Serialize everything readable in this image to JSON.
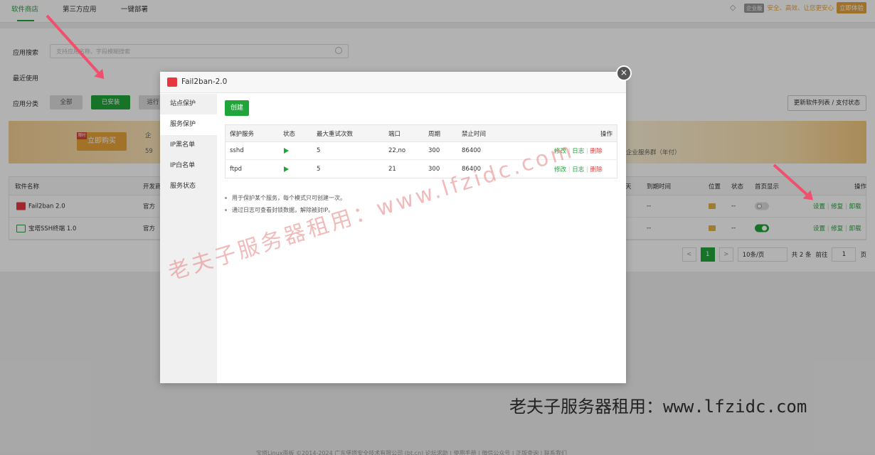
{
  "topbar": {
    "tabs": [
      "软件商店",
      "第三方应用",
      "一键部署"
    ],
    "vip_badge": "企业版",
    "slogan": "安全、高效、让您更安心",
    "experience_button": "立即体验"
  },
  "filters": {
    "search_label": "应用搜索",
    "search_placeholder": "支持应用名称、字段模糊搜索",
    "recent_label": "最近使用",
    "category_label": "应用分类",
    "categories": [
      "全部",
      "已安装",
      "运行"
    ],
    "refresh_button": "更新软件列表 / 支付状态"
  },
  "banner": {
    "tag": "限时",
    "buy_button": "立即购买",
    "text_right": "企业服务群（年付）",
    "text_a": "企",
    "text_b": "59"
  },
  "soft_table": {
    "headers": [
      "软件名称",
      "开发商",
      "天",
      "到期时间",
      "位置",
      "状态",
      "首页显示",
      "操作"
    ],
    "rows": [
      {
        "name": "Fail2ban 2.0",
        "developer": "官方",
        "expire": "--",
        "status": "--",
        "actions": [
          "设置",
          "修复",
          "卸载"
        ]
      },
      {
        "name": "宝塔SSH终端 1.0",
        "developer": "官方",
        "expire": "--",
        "status": "--",
        "actions": [
          "设置",
          "修复",
          "卸载"
        ]
      }
    ]
  },
  "pager": {
    "prev": "<",
    "current": "1",
    "next": ">",
    "per_page": "10条/页",
    "total": "共 2 条",
    "goto_label": "前往",
    "goto_value": "1",
    "page_unit": "页"
  },
  "modal": {
    "title": "Fail2ban-2.0",
    "close": "×",
    "side_items": [
      "站点保护",
      "服务保护",
      "IP黑名单",
      "IP白名单",
      "服务状态"
    ],
    "create_button": "创建",
    "table_headers": [
      "保护服务",
      "状态",
      "最大重试次数",
      "端口",
      "周期",
      "禁止时间",
      "操作"
    ],
    "rows": [
      {
        "service": "sshd",
        "retries": "5",
        "port": "22,no",
        "period": "300",
        "ban": "86400",
        "actions": [
          "修改",
          "日志",
          "删除"
        ]
      },
      {
        "service": "ftpd",
        "retries": "5",
        "port": "21",
        "period": "300",
        "ban": "86400",
        "actions": [
          "修改",
          "日志",
          "删除"
        ]
      }
    ],
    "tips": [
      "用于保护某个服务，每个模式只可创建一次。",
      "通过日志可查看封锁数据，解除被封IP。"
    ]
  },
  "watermark": "老夫子服务器租用：www.lfzidc.com",
  "caption": "老夫子服务器租用：www.lfzidc.com",
  "footer": "宝塔Linux面板 ©2014-2024 广东堡塔安全技术有限公司 (bt.cn)  论坛求助 | 使用手册 | 微信公众号 | 正版查询 | 联系我们"
}
